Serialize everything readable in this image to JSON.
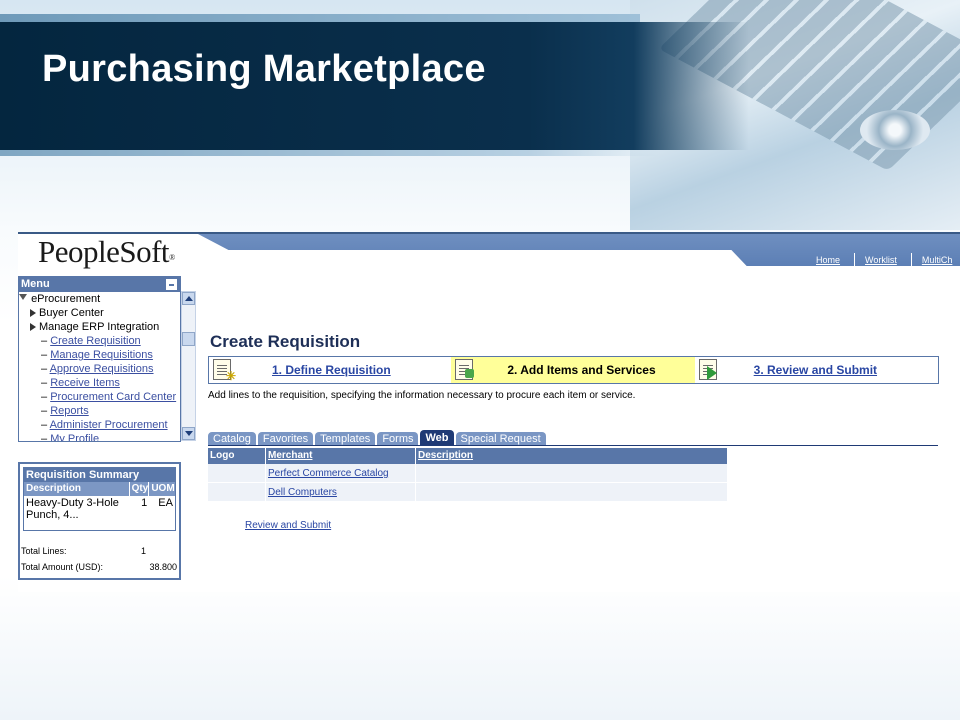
{
  "slide": {
    "title": "Purchasing Marketplace"
  },
  "app": {
    "logo": "PeopleSoft",
    "logo_mark": "®",
    "nav": [
      "Home",
      "Worklist",
      "MultiCh"
    ]
  },
  "menu": {
    "title": "Menu",
    "root": "eProcurement",
    "folders": [
      "Buyer Center",
      "Manage ERP Integration"
    ],
    "links": [
      "Create Requisition",
      "Manage Requisitions",
      "Approve Requisitions",
      "Receive Items",
      "Procurement Card Center",
      "Reports",
      "Administer Procurement",
      "My Profile"
    ]
  },
  "summary": {
    "title": "Requisition Summary",
    "columns": [
      "Description",
      "Qty",
      "UOM"
    ],
    "rows": [
      {
        "description": "Heavy-Duty 3-Hole Punch, 4...",
        "qty": "1",
        "uom": "EA"
      }
    ],
    "total_lines_label": "Total Lines:",
    "total_lines": "1",
    "total_amount_label": "Total Amount (USD):",
    "total_amount": "38.800"
  },
  "main": {
    "title": "Create Requisition",
    "steps": [
      "1. Define Requisition",
      "2. Add Items and Services",
      "3. Review and Submit"
    ],
    "instructions": "Add lines to the requisition, specifying the information necessary to procure each item or service.",
    "tabs": [
      "Catalog",
      "Favorites",
      "Templates",
      "Forms",
      "Web",
      "Special Request"
    ],
    "active_tab": "Web",
    "grid": {
      "columns": [
        "Logo",
        "Merchant",
        "Description"
      ],
      "rows": [
        {
          "logo": "",
          "merchant": "Perfect Commerce Catalog",
          "description": ""
        },
        {
          "logo": "",
          "merchant": "Dell Computers",
          "description": ""
        }
      ]
    },
    "review_link": "Review and Submit"
  },
  "colors": {
    "title_band": "#04263f",
    "header_blue": "#5876a8",
    "active_step": "#ffff99",
    "link": "#2946a3"
  }
}
